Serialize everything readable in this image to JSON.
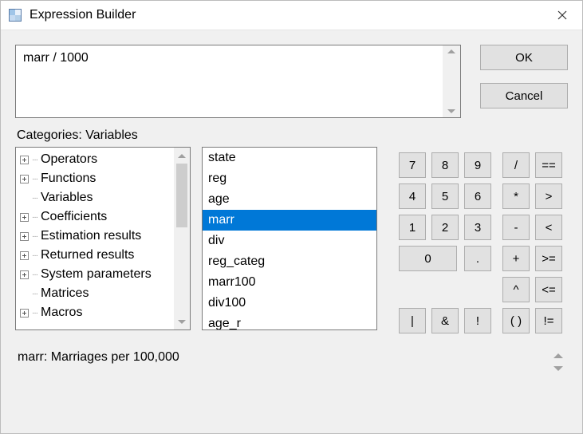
{
  "window": {
    "title": "Expression Builder"
  },
  "expression": {
    "text": "marr / 1000"
  },
  "buttons": {
    "ok": "OK",
    "cancel": "Cancel"
  },
  "categories_heading": "Categories: Variables",
  "tree": [
    {
      "label": "Operators",
      "expandable": true
    },
    {
      "label": "Functions",
      "expandable": true
    },
    {
      "label": "Variables",
      "expandable": false
    },
    {
      "label": "Coefficients",
      "expandable": true
    },
    {
      "label": "Estimation results",
      "expandable": true
    },
    {
      "label": "Returned results",
      "expandable": true
    },
    {
      "label": "System parameters",
      "expandable": true
    },
    {
      "label": "Matrices",
      "expandable": false
    },
    {
      "label": "Macros",
      "expandable": true
    }
  ],
  "list": {
    "items": [
      "state",
      "reg",
      "age",
      "marr",
      "div",
      "reg_categ",
      "marr100",
      "div100",
      "age_r"
    ],
    "selected_index": 3
  },
  "keypad": {
    "r0": [
      "7",
      "8",
      "9",
      "",
      "/",
      "=="
    ],
    "r1": [
      "4",
      "5",
      "6",
      "",
      "*",
      ">"
    ],
    "r2": [
      "1",
      "2",
      "3",
      "",
      "-",
      "<"
    ],
    "r3": [
      "0",
      "0",
      ".",
      "",
      "+",
      ">="
    ],
    "r4": [
      "",
      "",
      "",
      "",
      "^",
      "<="
    ],
    "r5": [
      "|",
      "&",
      "!",
      "",
      "( )",
      "!="
    ]
  },
  "description": "marr:  Marriages per 100,000"
}
